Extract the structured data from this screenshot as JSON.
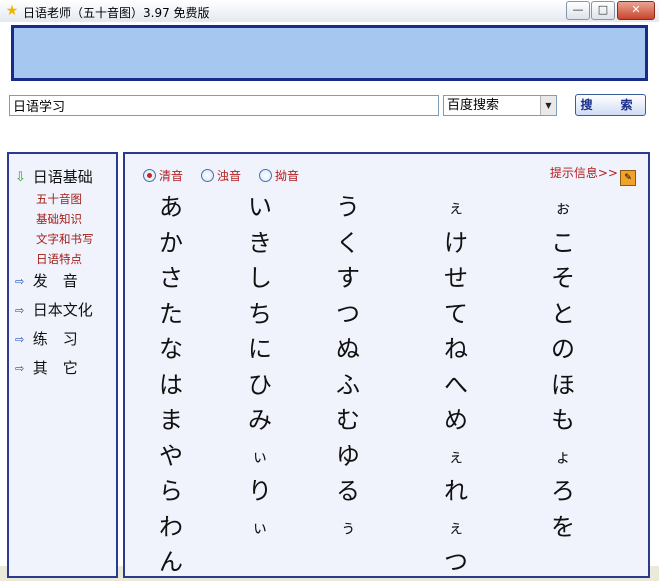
{
  "window": {
    "title": "日语老师（五十音图）3.97 免费版",
    "min_label": "—",
    "max_label": "□",
    "close_label": "✕"
  },
  "search": {
    "value": "日语学习",
    "engine": "百度搜索",
    "button_label": "搜　索"
  },
  "sidebar": {
    "sections": [
      {
        "label": "日语基础"
      },
      {
        "label": "发　音"
      },
      {
        "label": "日本文化"
      },
      {
        "label": "练　习"
      },
      {
        "label": "其　它"
      }
    ],
    "sub_items": [
      "五十音图",
      "基础知识",
      "文字和书写",
      "日语特点"
    ]
  },
  "content": {
    "radio": [
      "清音",
      "浊音",
      "拗音"
    ],
    "selected_radio": "清音",
    "hint": "提示信息>>",
    "columns": [
      [
        "あ",
        "か",
        "さ",
        "た",
        "な",
        "は",
        "ま",
        "や",
        "ら",
        "わ",
        "ん"
      ],
      [
        "い",
        "き",
        "し",
        "ち",
        "に",
        "ひ",
        "み",
        "ぃ",
        "り",
        "ぃ",
        ""
      ],
      [
        "う",
        "く",
        "す",
        "つ",
        "ぬ",
        "ふ",
        "む",
        "ゆ",
        "る",
        "ぅ",
        ""
      ],
      [
        "ぇ",
        "け",
        "せ",
        "て",
        "ね",
        "へ",
        "め",
        "ぇ",
        "れ",
        "ぇ",
        "つ"
      ],
      [
        "ぉ",
        "こ",
        "そ",
        "と",
        "の",
        "ほ",
        "も",
        "ょ",
        "ろ",
        "を",
        ""
      ]
    ]
  }
}
